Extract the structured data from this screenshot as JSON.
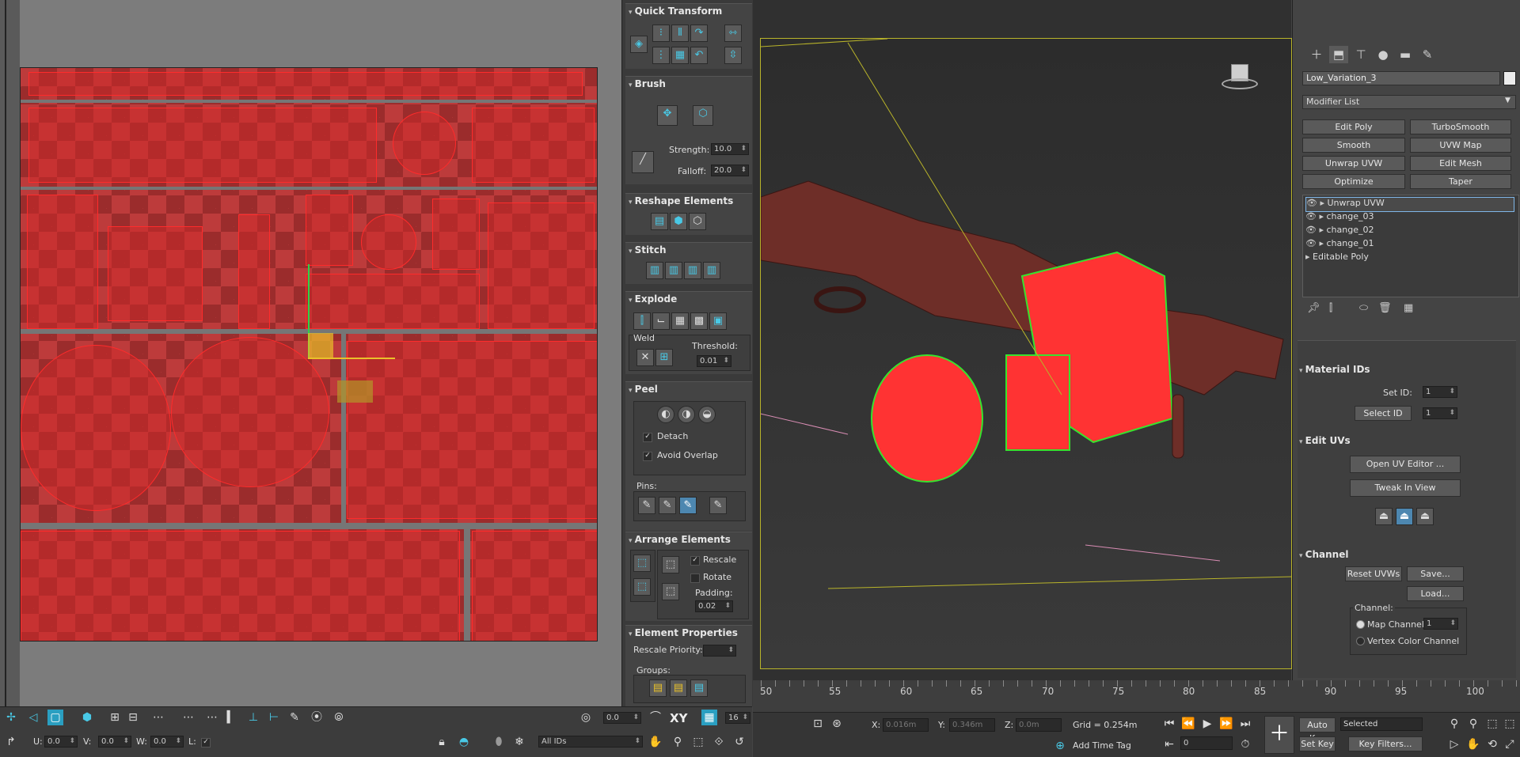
{
  "quick_transform": {
    "title": "Quick Transform"
  },
  "brush": {
    "title": "Brush",
    "strength_label": "Strength:",
    "strength_value": "10.0",
    "falloff_label": "Falloff:",
    "falloff_value": "20.0"
  },
  "reshape": {
    "title": "Reshape Elements"
  },
  "stitch": {
    "title": "Stitch"
  },
  "explode": {
    "title": "Explode",
    "weld_label": "Weld",
    "threshold_label": "Threshold:",
    "threshold_value": "0.01"
  },
  "peel": {
    "title": "Peel",
    "detach_label": "Detach",
    "detach_checked": true,
    "avoid_overlap_label": "Avoid Overlap",
    "avoid_overlap_checked": true,
    "pins_label": "Pins:"
  },
  "arrange": {
    "title": "Arrange Elements",
    "rescale_label": "Rescale",
    "rescale_checked": true,
    "rotate_label": "Rotate",
    "rotate_checked": false,
    "padding_label": "Padding:",
    "padding_value": "0.02"
  },
  "element_properties": {
    "title": "Element Properties",
    "rescale_priority_label": "Rescale Priority:",
    "groups_label": "Groups:"
  },
  "uv_bottom": {
    "zoom_value": "0.0",
    "xy_label": "XY",
    "grid_value": "16",
    "u_label": "U:",
    "u_value": "0.0",
    "v_label": "V:",
    "v_value": "0.0",
    "w_label": "W:",
    "w_value": "0.0",
    "l_label": "L:",
    "ids_dropdown": "All IDs"
  },
  "command_panel": {
    "object_name": "Low_Variation_3",
    "modifier_list": "Modifier List",
    "modifier_buttons": [
      "Edit Poly",
      "TurboSmooth",
      "Smooth",
      "UVW Map",
      "Unwrap UVW",
      "Edit Mesh",
      "Optimize",
      "Taper"
    ],
    "stack": [
      "Unwrap UVW",
      "change_03",
      "change_02",
      "change_01",
      "Editable Poly"
    ],
    "material_ids_title": "Material IDs",
    "set_id_label": "Set ID:",
    "set_id_value": "1",
    "select_id_label": "Select ID",
    "select_id_value": "1",
    "edit_uvs_title": "Edit UVs",
    "open_uv_editor": "Open UV Editor ...",
    "tweak_in_view": "Tweak In View",
    "channel_title": "Channel",
    "reset_uvws": "Reset UVWs",
    "save": "Save...",
    "load": "Load...",
    "channel_group": "Channel:",
    "map_channel_label": "Map Channel:",
    "map_channel_value": "1",
    "map_channel_selected": true,
    "vertex_color_channel": "Vertex Color Channel"
  },
  "timeline": {
    "ticks": [
      "50",
      "55",
      "60",
      "65",
      "70",
      "75",
      "80",
      "85",
      "90",
      "95",
      "100"
    ]
  },
  "status_bar": {
    "x_label": "X:",
    "x_value": "0.016m",
    "y_label": "Y:",
    "y_value": "0.346m",
    "z_label": "Z:",
    "z_value": "0.0m",
    "grid": "Grid = 0.254m",
    "add_time_tag": "Add Time Tag",
    "auto_key": "Auto Key",
    "selected": "Selected",
    "set_key": "Set Key",
    "key_filters": "Key Filters...",
    "frame_value": "0"
  },
  "colors": {
    "selection_red": "#ff2b2b",
    "checker_red": "#bd3b3b",
    "viewport_border": "#b9b42a",
    "accent_blue": "#49c9e6",
    "gizmo_green": "#2dd34a",
    "gizmo_yellow": "#e9c12a"
  }
}
